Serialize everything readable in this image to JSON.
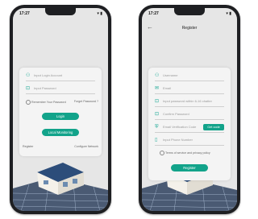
{
  "login": {
    "status_time": "17:27",
    "account_placeholder": "Input Login Account",
    "password_placeholder": "Input Password",
    "remember_label": "Remember Your Password",
    "forgot_label": "Forget Password ?",
    "login_button": "Login",
    "local_monitoring_button": "Local Monitoring",
    "register_link": "Register",
    "configure_network_link": "Configure Network"
  },
  "register": {
    "status_time": "17:27",
    "title": "Register",
    "username_placeholder": "Username",
    "email_placeholder": "Email",
    "password_placeholder": "Input password within 6-16 chatter",
    "confirm_password_placeholder": "Confirm Password",
    "verification_placeholder": "Email Verification Code",
    "get_code_button": "Get code",
    "phone_placeholder": "Input Phone Number",
    "terms_label": "Terms of service and privacy policy",
    "register_button": "Register"
  },
  "colors": {
    "accent": "#12a38a",
    "phone_frame": "#1e1f22"
  }
}
